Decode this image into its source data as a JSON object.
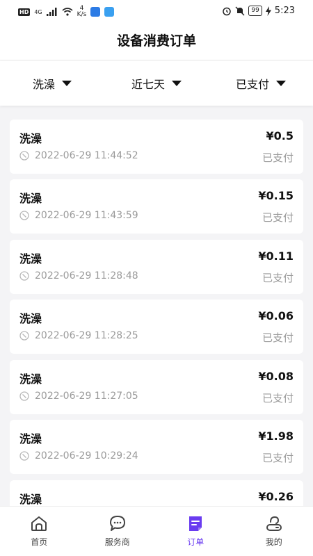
{
  "status_bar": {
    "hd": "HD",
    "signal": "4G",
    "speed_value": "4",
    "speed_unit": "K/s",
    "battery": "99",
    "time": "5:23"
  },
  "header": {
    "title": "设备消费订单"
  },
  "filters": [
    {
      "label": "洗澡"
    },
    {
      "label": "近七天"
    },
    {
      "label": "已支付"
    }
  ],
  "orders": [
    {
      "name": "洗澡",
      "price": "¥0.5",
      "time": "2022-06-29 11:44:52",
      "status": "已支付"
    },
    {
      "name": "洗澡",
      "price": "¥0.15",
      "time": "2022-06-29 11:43:59",
      "status": "已支付"
    },
    {
      "name": "洗澡",
      "price": "¥0.11",
      "time": "2022-06-29 11:28:48",
      "status": "已支付"
    },
    {
      "name": "洗澡",
      "price": "¥0.06",
      "time": "2022-06-29 11:28:25",
      "status": "已支付"
    },
    {
      "name": "洗澡",
      "price": "¥0.08",
      "time": "2022-06-29 11:27:05",
      "status": "已支付"
    },
    {
      "name": "洗澡",
      "price": "¥1.98",
      "time": "2022-06-29 10:29:24",
      "status": "已支付"
    },
    {
      "name": "洗澡",
      "price": "¥0.26",
      "time": "",
      "status": ""
    }
  ],
  "tabbar": {
    "active_color": "#6a3cf0",
    "items": [
      {
        "label": "首页",
        "icon": "home-icon"
      },
      {
        "label": "服务商",
        "icon": "chat-icon"
      },
      {
        "label": "订单",
        "icon": "order-icon"
      },
      {
        "label": "我的",
        "icon": "profile-icon"
      }
    ]
  }
}
